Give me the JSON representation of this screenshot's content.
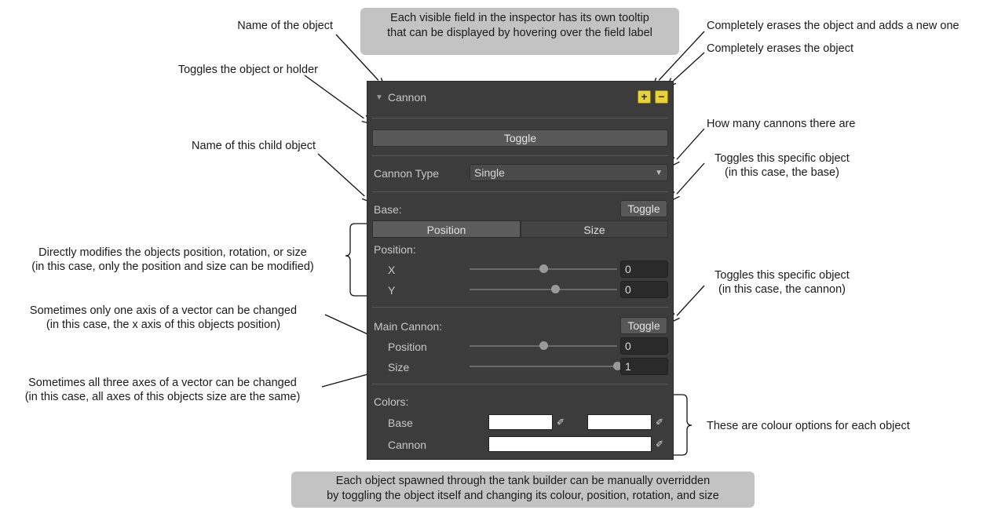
{
  "annotations": {
    "name_of_object": "Name of the object",
    "toggles_object_or_holder": "Toggles the object or holder",
    "name_of_child": "Name of this child object",
    "directly_modifies_line1": "Directly modifies the objects position, rotation, or size",
    "directly_modifies_line2": "(in this case, only the position and size can be modified)",
    "one_axis_line1": "Sometimes only one axis of a vector can be changed",
    "one_axis_line2": "(in this case, the x axis of this objects position)",
    "three_axes_line1": "Sometimes all three axes of a vector can be changed",
    "three_axes_line2": "(in this case, all axes of this objects size are the same)",
    "erase_and_add": "Completely erases the object and adds a new one",
    "erase": "Completely erases the object",
    "how_many": "How many cannons there are",
    "toggles_base_line1": "Toggles this specific object",
    "toggles_base_line2": "(in this case, the base)",
    "toggles_cannon_line1": "Toggles this specific object",
    "toggles_cannon_line2": "(in this case, the cannon)",
    "colour_options": "These are colour options for each object"
  },
  "tooltip_bubble": {
    "line1": "Each visible field in the inspector has its own tooltip",
    "line2": "that can be displayed by hovering over the field label"
  },
  "footer_bubble": {
    "line1": "Each object spawned through the tank builder can be manually overridden",
    "line2": "by toggling the object itself and changing its colour, position, rotation, and size"
  },
  "inspector": {
    "header": {
      "arrow": "▼",
      "title": "Cannon",
      "add_symbol": "+",
      "remove_symbol": "−"
    },
    "toggle_label": "Toggle",
    "cannon_type": {
      "label": "Cannon Type",
      "value": "Single",
      "arrow": "▼"
    },
    "base": {
      "label": "Base:",
      "toggle_label": "Toggle",
      "tabs": [
        "Position",
        "Size"
      ],
      "active_tab": "Position",
      "position_label": "Position:",
      "x": {
        "label": "X",
        "value": "0",
        "slider_fraction": 0.5
      },
      "y": {
        "label": "Y",
        "value": "0",
        "slider_fraction": 0.58
      }
    },
    "main_cannon": {
      "label": "Main Cannon:",
      "toggle_label": "Toggle",
      "position": {
        "label": "Position",
        "value": "0",
        "slider_fraction": 0.5
      },
      "size": {
        "label": "Size",
        "value": "1",
        "slider_fraction": 1.0
      }
    },
    "colors": {
      "label": "Colors:",
      "base_label": "Base",
      "cannon_label": "Cannon",
      "base_color_1": "#ffffff",
      "base_color_2": "#ffffff",
      "cannon_color": "#ffffff",
      "picker_icon": "eyedropper-icon"
    }
  },
  "colors": {
    "panel_bg": "#3c3c3c",
    "bubble_bg": "#c3c3c3",
    "add_remove_button": "#e8d13a"
  }
}
